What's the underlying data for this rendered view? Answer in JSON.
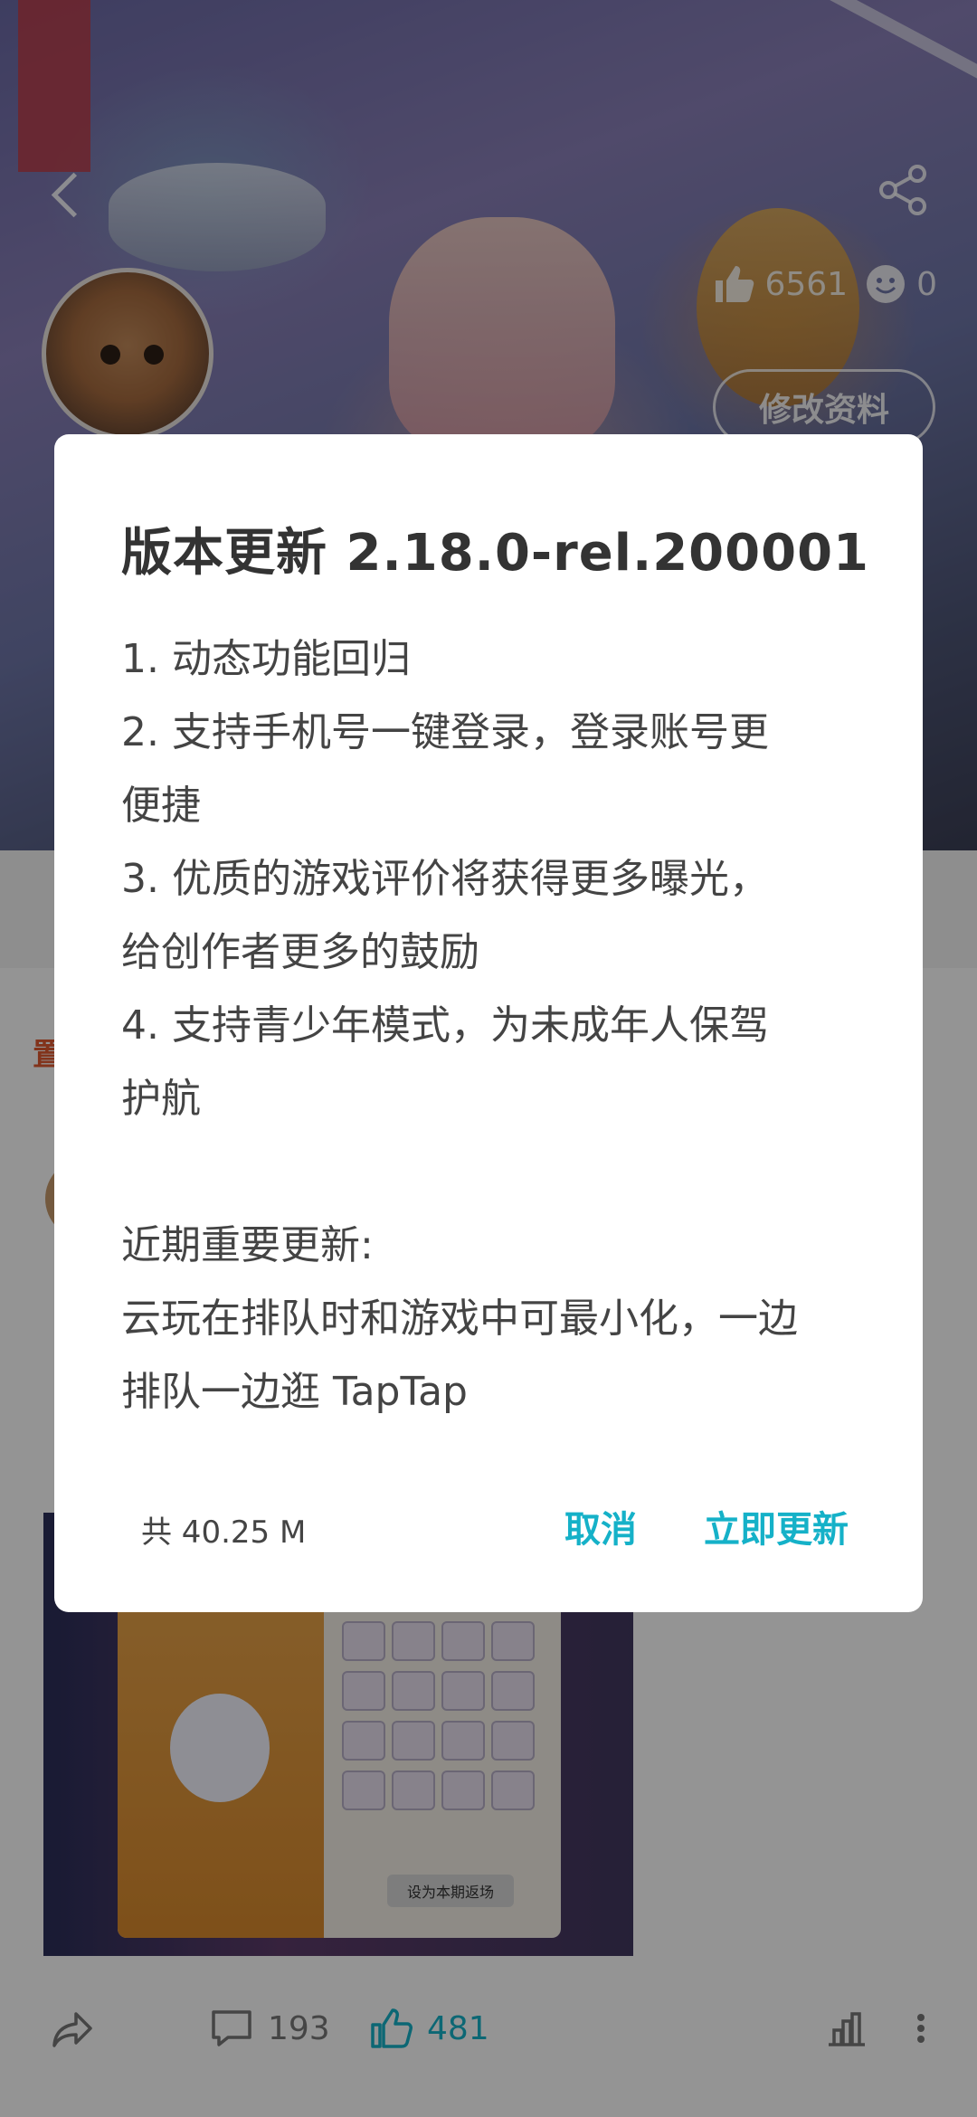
{
  "profile": {
    "likes_count": "6561",
    "face_count": "0",
    "edit_profile_label": "修改资料"
  },
  "feed": {
    "pinned_tag": "置",
    "post_image_button": "设为本期返场",
    "comments_count": "193",
    "likes_count": "481"
  },
  "dialog": {
    "title": "版本更新 2.18.0-rel.200001",
    "notes": [
      "1. 动态功能回归",
      "2. 支持手机号一键登录，登录账号更",
      "便捷",
      "3. 优质的游戏评价将获得更多曝光，",
      "给创作者更多的鼓励",
      "4. 支持青少年模式，为未成年人保驾",
      "护航",
      "",
      "近期重要更新:",
      "云玩在排队时和游戏中可最小化，一边",
      "排队一边逛 TapTap"
    ],
    "size_label": "共 40.25 M",
    "cancel_label": "取消",
    "update_label": "立即更新"
  },
  "colors": {
    "accent": "#15b1c8",
    "pinned": "#e0582f"
  }
}
